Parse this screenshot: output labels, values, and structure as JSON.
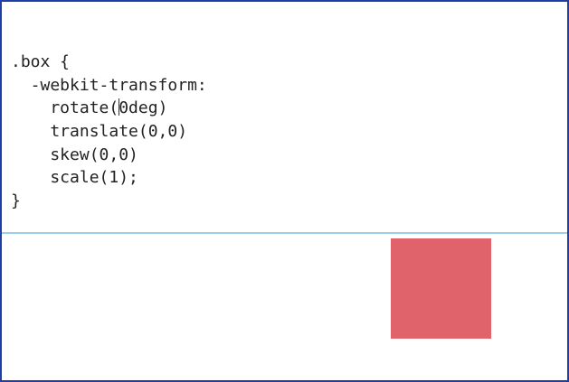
{
  "editor": {
    "lines": [
      {
        "text": ".box {"
      },
      {
        "text": "  -webkit-transform:"
      },
      {
        "before": "    rotate(",
        "after": "0deg)"
      },
      {
        "text": "    translate(0,0)"
      },
      {
        "text": "    skew(0,0)"
      },
      {
        "text": "    scale(1);"
      },
      {
        "text": "}"
      }
    ]
  },
  "preview": {
    "box_color": "#e0636c",
    "divider_color": "#9dd0e8"
  }
}
